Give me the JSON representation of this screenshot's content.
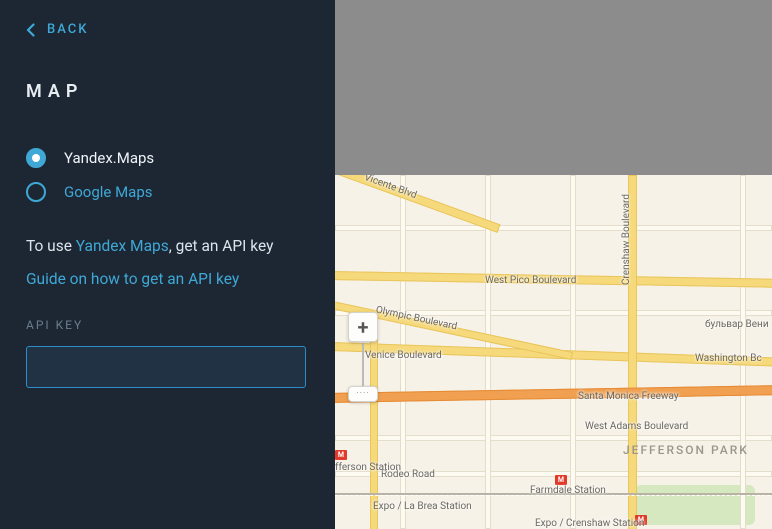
{
  "back": {
    "label": "BACK"
  },
  "title": "MAP",
  "providers": [
    {
      "key": "yandex",
      "label": "Yandex.Maps",
      "selected": true
    },
    {
      "key": "google",
      "label": "Google Maps",
      "selected": false
    }
  ],
  "help": {
    "prefix": "To use ",
    "link_text": "Yandex Maps",
    "suffix": ", get an API key"
  },
  "guide_link": "Guide on how to get an API key",
  "api_key": {
    "label": "API KEY",
    "value": ""
  },
  "zoom": {
    "in": "+",
    "ruler": "····"
  },
  "map_labels": {
    "vicente": "Vicente Blvd",
    "pico": "West Pico Boulevard",
    "venice": "Venice Boulevard",
    "olympic": "Olympic Boulevard",
    "santa_monica": "Santa Monica Freeway",
    "washington": "Washington Bc",
    "crenshaw": "Crenshaw Boulevard",
    "venice_ru": "бульвар Вени",
    "west_adams": "West Adams Boulevard",
    "rodeo": "Rodeo Road",
    "jefferson_park": "JEFFERSON PARK",
    "jefferson_station": "fferson Station",
    "farmdale": "Farmdale Station",
    "expo_labrea": "Expo / La Brea Station",
    "expo_crenshaw": "Expo / Crenshaw Station"
  }
}
